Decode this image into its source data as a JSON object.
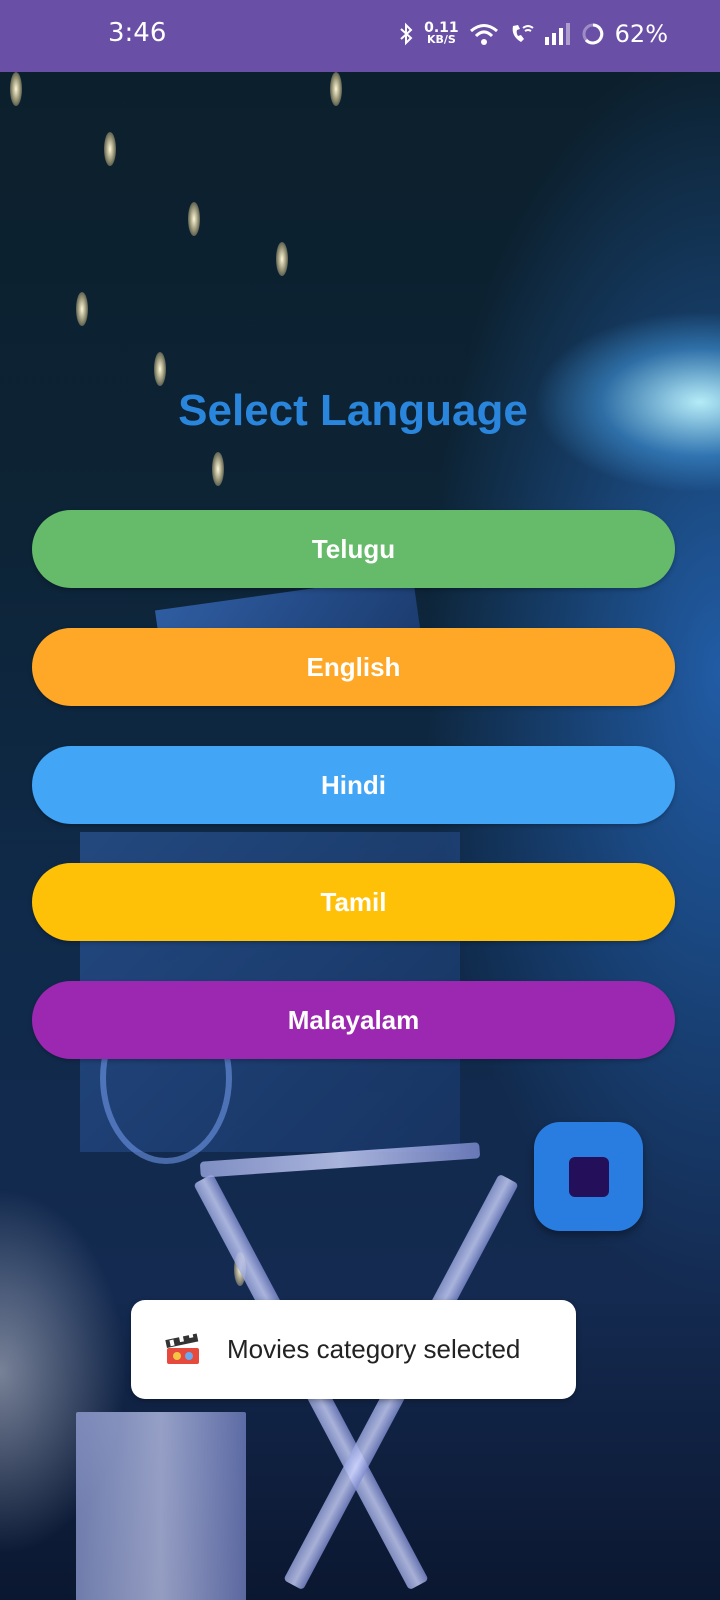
{
  "status_bar": {
    "time": "3:46",
    "net_speed_value": "0.11",
    "net_speed_unit": "KB/S",
    "battery": "62%",
    "icons": [
      "bluetooth-icon",
      "wifi-icon",
      "wifi-call-icon",
      "signal-icon",
      "battery-ring-icon"
    ]
  },
  "screen": {
    "title": "Select Language",
    "title_color": "#2a86dc"
  },
  "languages": [
    {
      "label": "Telugu",
      "color": "#66bb6a"
    },
    {
      "label": "English",
      "color": "#ffa726"
    },
    {
      "label": "Hindi",
      "color": "#42a5f5"
    },
    {
      "label": "Tamil",
      "color": "#ffc107"
    },
    {
      "label": "Malayalam",
      "color": "#9c27b0"
    }
  ],
  "fab": {
    "icon": "stop-icon",
    "color": "#2a7de0"
  },
  "toast": {
    "icon": "movie-clapper-icon",
    "message": "Movies category selected"
  }
}
